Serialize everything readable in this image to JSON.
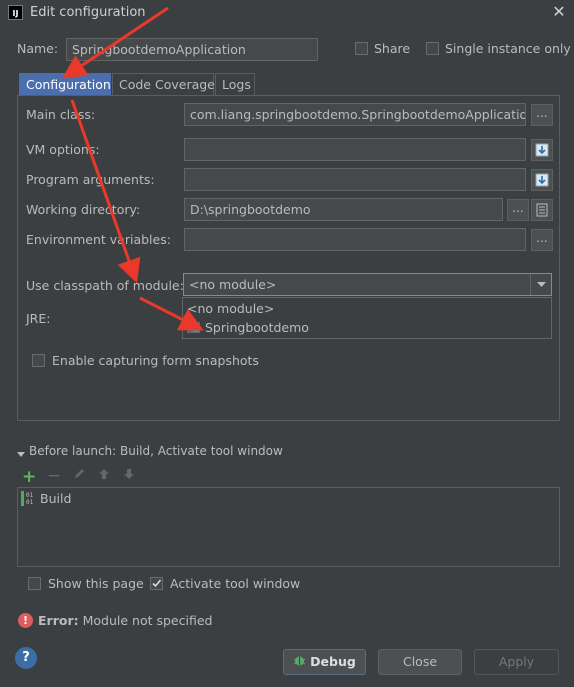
{
  "window": {
    "title": "Edit configuration",
    "app_icon_text": "IJ"
  },
  "name_row": {
    "label": "Name:",
    "value": "SpringbootdemoApplication",
    "share_label": "Share",
    "single_instance_label": "Single instance only"
  },
  "tabs": [
    {
      "label": "Configuration"
    },
    {
      "label": "Code Coverage"
    },
    {
      "label": "Logs"
    }
  ],
  "config": {
    "main_class_label": "Main class:",
    "main_class_value": "com.liang.springbootdemo.SpringbootdemoApplication",
    "vm_options_label": "VM options:",
    "program_args_label": "Program arguments:",
    "working_dir_label": "Working directory:",
    "working_dir_value": "D:\\springbootdemo",
    "env_vars_label": "Environment variables:",
    "classpath_label": "Use classpath of module:",
    "classpath_value": "<no module>",
    "jre_label": "JRE:",
    "capture_label": "Enable capturing form snapshots",
    "ellipsis": "..."
  },
  "module_dropdown": {
    "options": [
      "<no module>",
      "Springbootdemo"
    ]
  },
  "before_launch": {
    "header": "Before launch: Build, Activate tool window",
    "items": [
      "Build"
    ]
  },
  "options": {
    "show_page_label": "Show this page",
    "activate_tool_label": "Activate tool window"
  },
  "error": {
    "prefix": "Error:",
    "message": "Module not specified"
  },
  "buttons": {
    "debug": "Debug",
    "close": "Close",
    "apply": "Apply",
    "help": "?"
  }
}
